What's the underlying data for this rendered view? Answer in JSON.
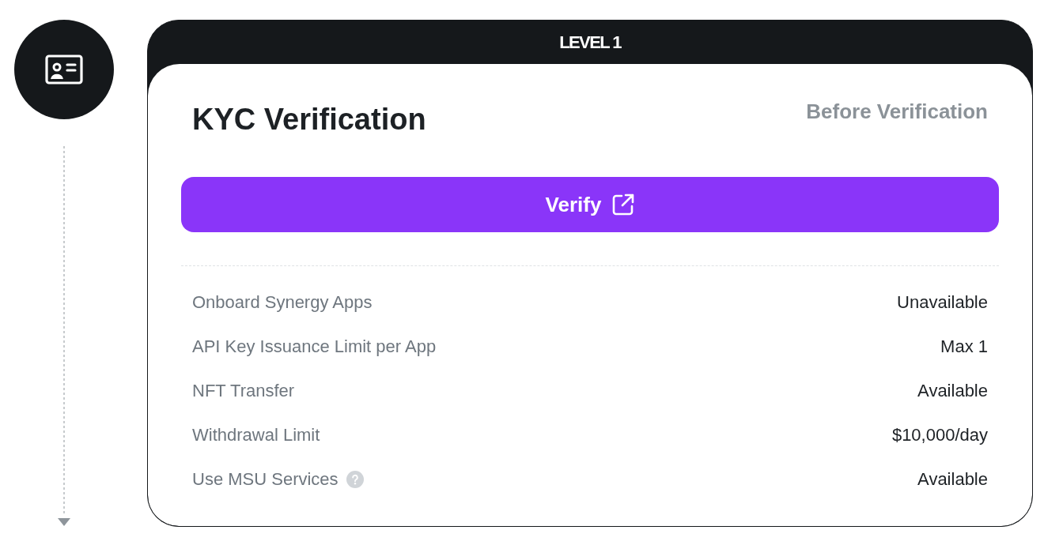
{
  "level": {
    "label": "LEVEL 1"
  },
  "card": {
    "title": "KYC Verification",
    "status": "Before Verification",
    "action": {
      "label": "Verify"
    },
    "features": [
      {
        "label": "Onboard Synergy Apps",
        "value": "Unavailable",
        "help": false
      },
      {
        "label": "API Key Issuance Limit per App",
        "value": "Max 1",
        "help": false
      },
      {
        "label": "NFT Transfer",
        "value": "Available",
        "help": false
      },
      {
        "label": "Withdrawal Limit",
        "value": "$10,000/day",
        "help": false
      },
      {
        "label": "Use MSU Services",
        "value": "Available",
        "help": true
      }
    ]
  }
}
